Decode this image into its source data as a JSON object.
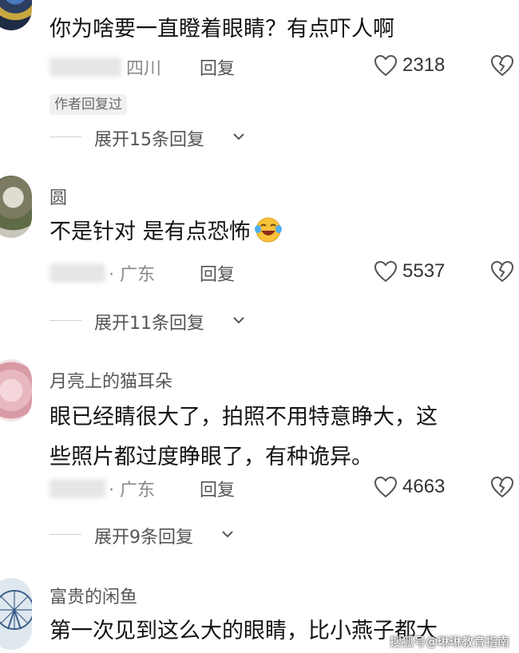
{
  "comments": [
    {
      "username": "",
      "text_lines": [
        "你为啥要一直瞪着眼睛？有点吓人啊"
      ],
      "location": "四川",
      "reply_label": "回复",
      "likes": "2318",
      "badge": "作者回复过",
      "expand_label": "展开15条回复"
    },
    {
      "username": "圆",
      "text_lines": [
        "不是针对 是有点恐怖"
      ],
      "emoji": "laughing-crying-emoji",
      "location": "· 广东",
      "reply_label": "回复",
      "likes": "5537",
      "expand_label": "展开11条回复"
    },
    {
      "username": "月亮上的猫耳朵",
      "text_lines": [
        "眼已经睛很大了，拍照不用特意睁大，这",
        "些照片都过度睁眼了，有种诡异。"
      ],
      "location": "· 广东",
      "reply_label": "回复",
      "likes": "4663",
      "expand_label": "展开9条回复"
    },
    {
      "username": "富贵的闲鱼",
      "text_lines": [
        "第一次见到这么大的眼睛，比小燕子都大"
      ]
    }
  ],
  "watermark": "搜狐号@琳琳教育指南",
  "colors": {
    "background": "#ffffff",
    "text": "#141414",
    "muted": "#8a8a8a",
    "divider": "#cfcfcf",
    "badge_bg": "#f0f0f0"
  },
  "icons": {
    "like": "heart-outline-icon",
    "dislike": "broken-heart-icon",
    "expand": "chevron-down-icon"
  }
}
